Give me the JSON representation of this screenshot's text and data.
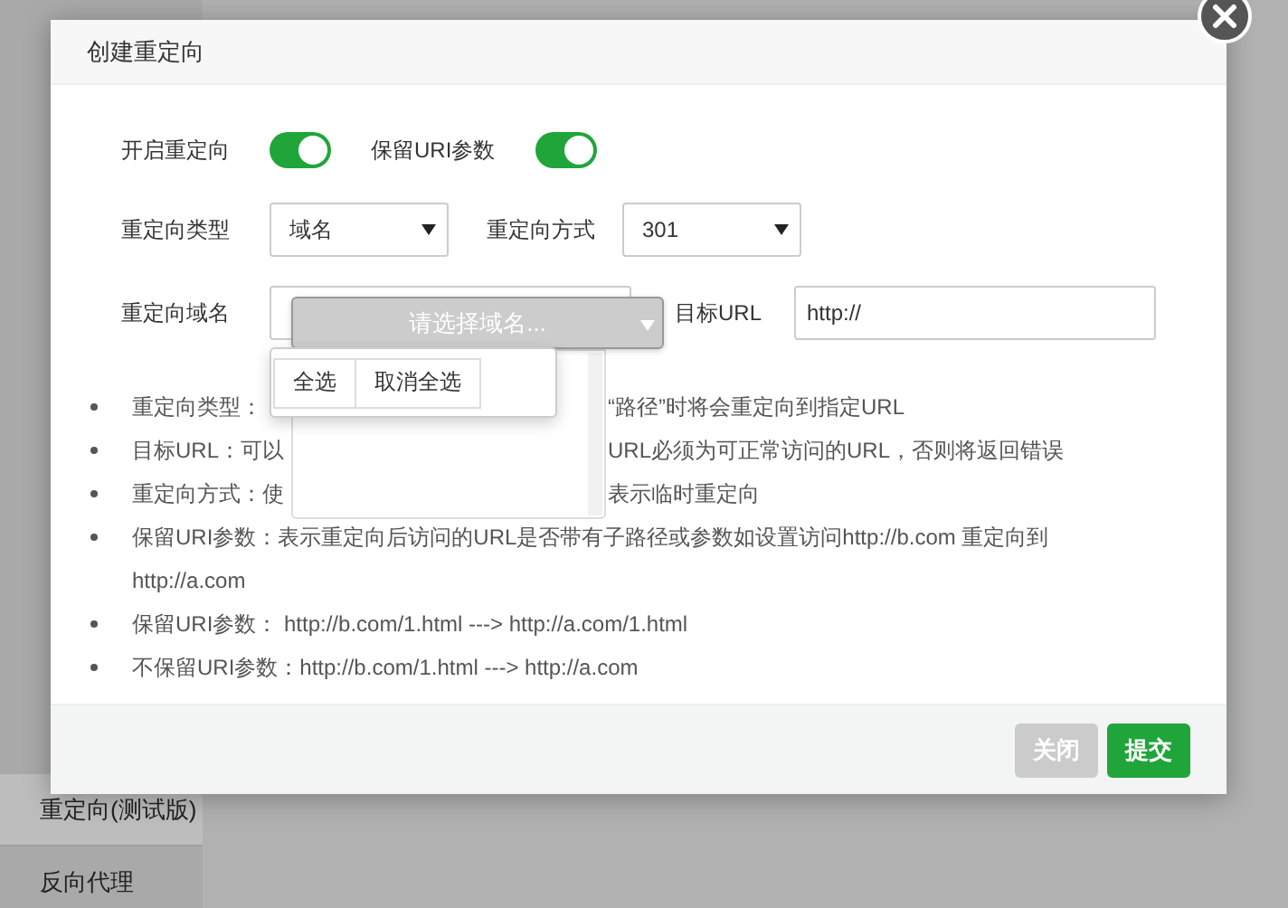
{
  "sidebar": {
    "items": [
      {
        "label": "重定向(测试版)",
        "selected": true
      },
      {
        "label": "反向代理",
        "selected": false
      }
    ]
  },
  "dialog": {
    "title": "创建重定向",
    "switches": [
      {
        "label": "开启重定向",
        "on": true
      },
      {
        "label": "保留URI参数",
        "on": true
      }
    ],
    "selects": [
      {
        "label": "重定向类型",
        "value": "域名"
      },
      {
        "label": "重定向方式",
        "value": "301"
      }
    ],
    "domain": {
      "label": "重定向域名",
      "picker": "请选择域名...",
      "menu": [
        "全选",
        "取消全选"
      ]
    },
    "target": {
      "label": "目标URL",
      "value": "http://"
    },
    "notes": [
      {
        "text": "重定向类型：",
        "text_after": "“路径”时将会重定向到指定URL"
      },
      {
        "text": "目标URL：可以",
        "text_after": "URL必须为可正常访问的URL，否则将返回错误"
      },
      {
        "text": "重定向方式：使",
        "text_after": "表示临时重定向"
      },
      {
        "text": "保留URI参数：表示重定向后访问的URL是否带有子路径或参数如设置访问http://b.com 重定向到 http://a.com"
      },
      {
        "text": "保留URI参数： http://b.com/1.html ---> http://a.com/1.html"
      },
      {
        "text": "不保留URI参数：http://b.com/1.html ---> http://a.com"
      }
    ],
    "buttons": [
      {
        "label": "关闭",
        "kind": "secondary"
      },
      {
        "label": "提交",
        "kind": "primary"
      }
    ]
  }
}
